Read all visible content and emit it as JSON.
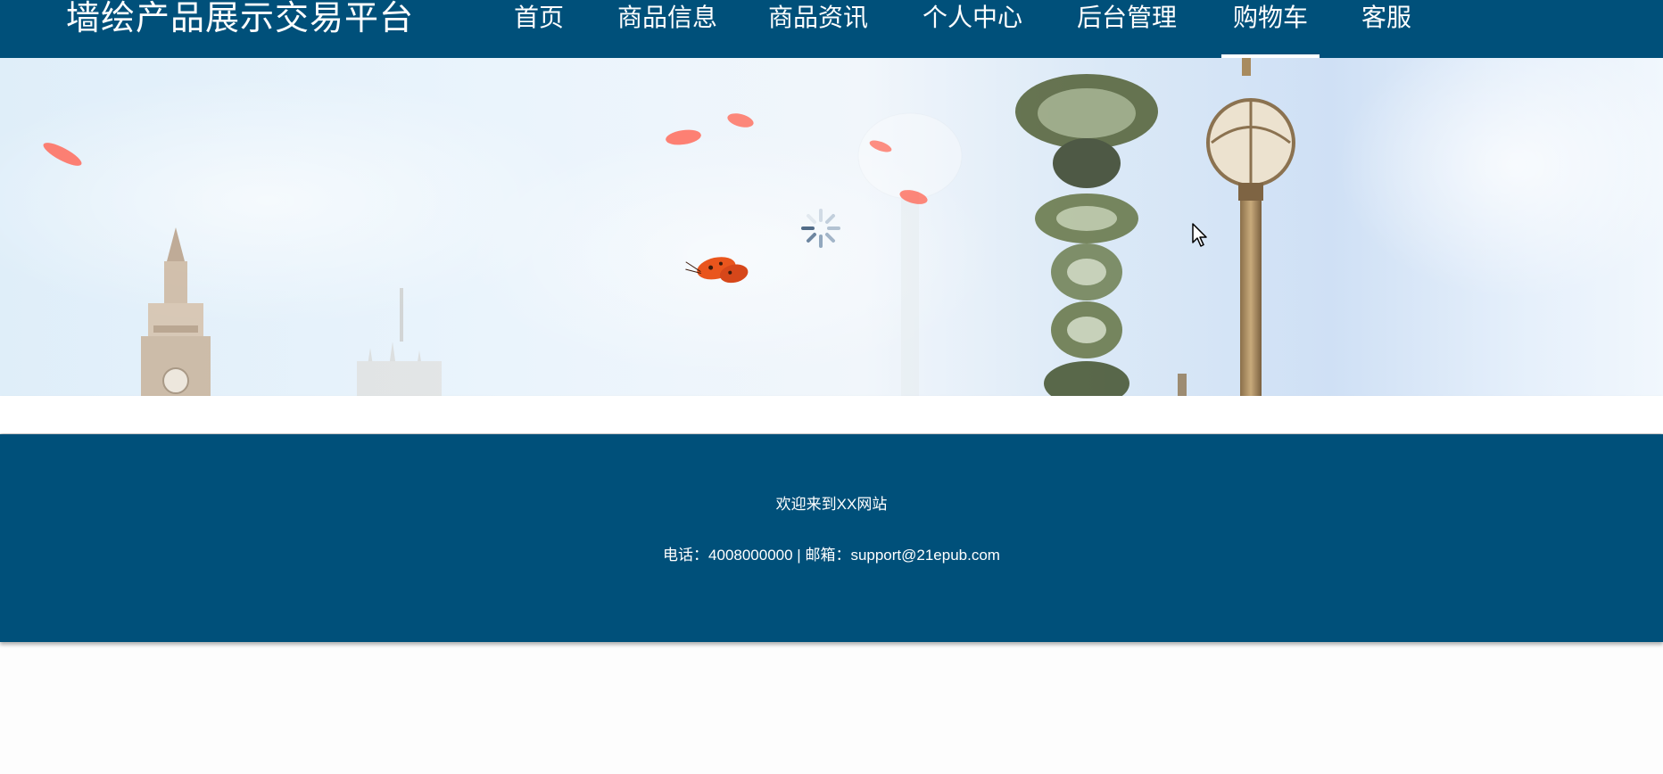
{
  "header": {
    "site_title": "墙绘产品展示交易平台",
    "nav": [
      {
        "label": "首页"
      },
      {
        "label": "商品信息"
      },
      {
        "label": "商品资讯"
      },
      {
        "label": "个人中心"
      },
      {
        "label": "后台管理"
      },
      {
        "label": "购物车",
        "active": true
      },
      {
        "label": "客服"
      }
    ]
  },
  "banner": {
    "loading": true
  },
  "footer": {
    "welcome": "欢迎来到XX网站",
    "contact": "电话：4008000000 | 邮箱：support@21epub.com"
  },
  "colors": {
    "brand_blue": "#00507a",
    "text_light": "#ffffff"
  }
}
